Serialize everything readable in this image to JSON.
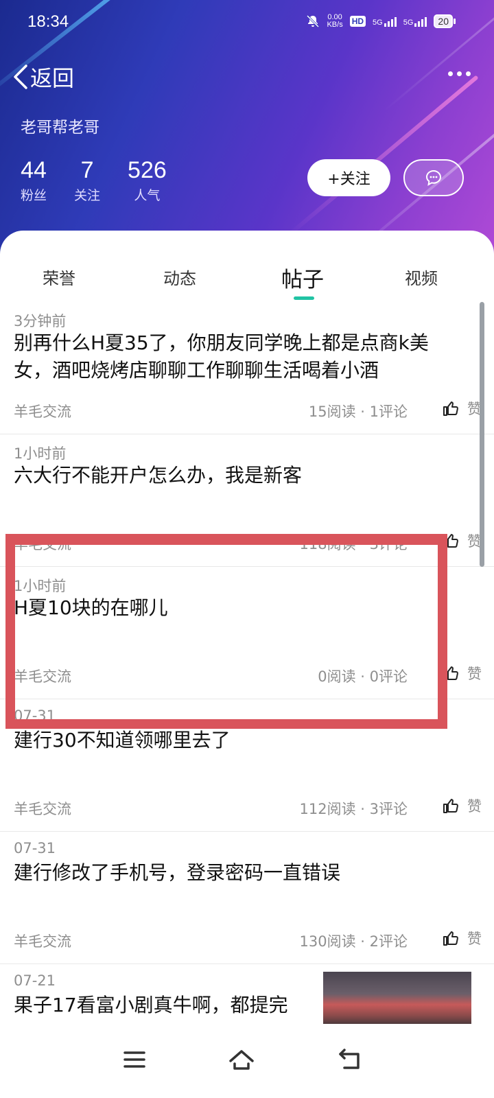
{
  "status_bar": {
    "time": "18:34",
    "net_speed_value": "0.00",
    "net_speed_unit": "KB/s",
    "hd_label": "HD",
    "sim1_label": "5G",
    "sim2_label": "5G",
    "battery": "20"
  },
  "header": {
    "back_label": "返回",
    "username": "老哥帮老哥",
    "stats": [
      {
        "value": "44",
        "label": "粉丝"
      },
      {
        "value": "7",
        "label": "关注"
      },
      {
        "value": "526",
        "label": "人气"
      }
    ],
    "follow_label": "+关注"
  },
  "tabs": [
    {
      "label": "荣誉",
      "active": false
    },
    {
      "label": "动态",
      "active": false
    },
    {
      "label": "帖子",
      "active": true
    },
    {
      "label": "视频",
      "active": false
    }
  ],
  "posts": [
    {
      "time": "3分钟前",
      "title": "别再什么H夏35了，你朋友同学晚上都是点商k美女，酒吧烧烤店聊聊工作聊聊生活喝着小酒",
      "category": "羊毛交流",
      "meta": "15阅读 · 1评论",
      "like": "赞"
    },
    {
      "time": "1小时前",
      "title": "六大行不能开户怎么办，我是新客",
      "category": "羊毛交流",
      "meta": "118阅读 · 3评论",
      "like": "赞"
    },
    {
      "time": "1小时前",
      "title": "H夏10块的在哪儿",
      "category": "羊毛交流",
      "meta": "0阅读 · 0评论",
      "like": "赞"
    },
    {
      "time": "07-31",
      "title": "建行30不知道领哪里去了",
      "category": "羊毛交流",
      "meta": "112阅读 · 3评论",
      "like": "赞"
    },
    {
      "time": "07-31",
      "title": "建行修改了手机号，登录密码一直错误",
      "category": "羊毛交流",
      "meta": "130阅读 · 2评论",
      "like": "赞"
    },
    {
      "time": "07-21",
      "title": "果子17看富小剧真牛啊，都提完",
      "category": "",
      "meta": "",
      "like": ""
    }
  ],
  "colors": {
    "accent": "#21c3a4",
    "highlight": "#d9545b",
    "muted_text": "#8e8e8e"
  },
  "icons": [
    "back-chevron-icon",
    "more-dots-icon",
    "chat-bubble-icon",
    "thumbs-up-icon",
    "menu-icon",
    "home-icon",
    "back-nav-icon"
  ]
}
